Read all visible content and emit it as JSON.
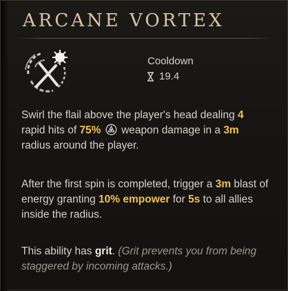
{
  "ability": {
    "title": "ARCANE VORTEX",
    "icon": "flail-vortex-icon"
  },
  "cooldown": {
    "label": "Cooldown",
    "value": "19.4",
    "icon": "hourglass-icon"
  },
  "description": {
    "p1": {
      "t1": "Swirl the flail above the player's head dealing ",
      "hits": "4",
      "t2": " rapid hits of ",
      "percent": "75%",
      "t3": " weapon damage in a ",
      "radius": "3m",
      "t4": " radius around the player."
    },
    "p2": {
      "t1": "After the first spin is completed, trigger a ",
      "blast": "3m",
      "t2": " blast of energy granting ",
      "empower": "10% empower",
      "t3": " for ",
      "duration": "5s",
      "t4": " to all allies inside the radius."
    },
    "p3": {
      "t1": "This ability has ",
      "grit": "grit",
      "t2": ". ",
      "note": "(Grit prevents you from being staggered by incoming attacks.)"
    }
  },
  "colors": {
    "title": "#d7c6a6",
    "highlight": "#f0c24a",
    "body_text": "#d6d2cc",
    "note_text": "#9c978f"
  }
}
